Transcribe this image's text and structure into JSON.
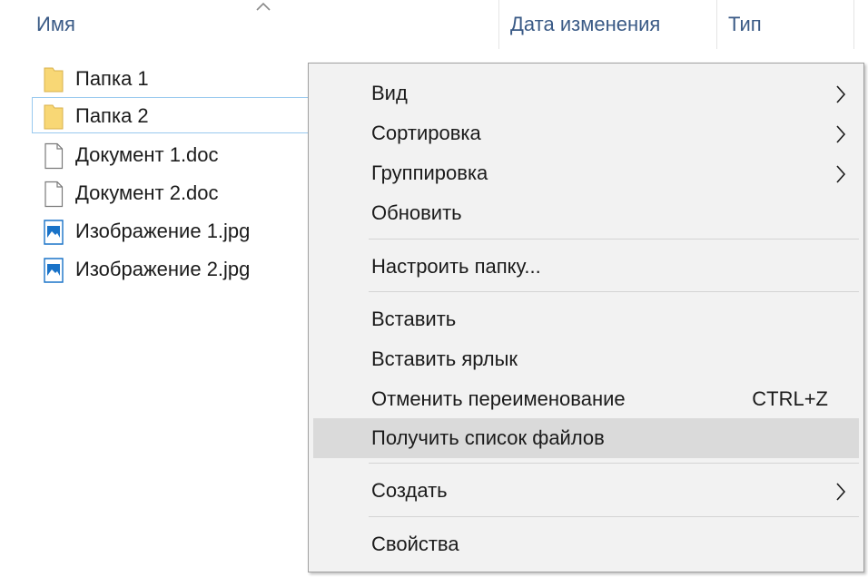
{
  "columns": {
    "name": "Имя",
    "date_modified": "Дата изменения",
    "type": "Тип"
  },
  "files": [
    {
      "name": "Папка 1",
      "icon": "folder-icon"
    },
    {
      "name": "Папка 2",
      "icon": "folder-icon",
      "selected": true
    },
    {
      "name": "Документ 1.doc",
      "icon": "document-icon"
    },
    {
      "name": "Документ 2.doc",
      "icon": "document-icon"
    },
    {
      "name": "Изображение 1.jpg",
      "icon": "image-icon"
    },
    {
      "name": "Изображение 2.jpg",
      "icon": "image-icon"
    }
  ],
  "context_menu": {
    "items": [
      {
        "label": "Вид",
        "submenu": true
      },
      {
        "label": "Сортировка",
        "submenu": true
      },
      {
        "label": "Группировка",
        "submenu": true
      },
      {
        "label": "Обновить"
      },
      {
        "label": "Настроить папку..."
      },
      {
        "label": "Вставить"
      },
      {
        "label": "Вставить ярлык"
      },
      {
        "label": "Отменить переименование",
        "shortcut": "CTRL+Z"
      },
      {
        "label": "Получить список файлов",
        "highlighted": true
      },
      {
        "label": "Создать",
        "submenu": true
      },
      {
        "label": "Свойства"
      }
    ]
  },
  "colors": {
    "header_text": "#3a5a86",
    "selection_border": "#99c9ef",
    "menu_background": "#f2f2f2",
    "menu_highlight": "#dadada",
    "folder_yellow": "#f8d775",
    "image_blue": "#1a73c8"
  }
}
